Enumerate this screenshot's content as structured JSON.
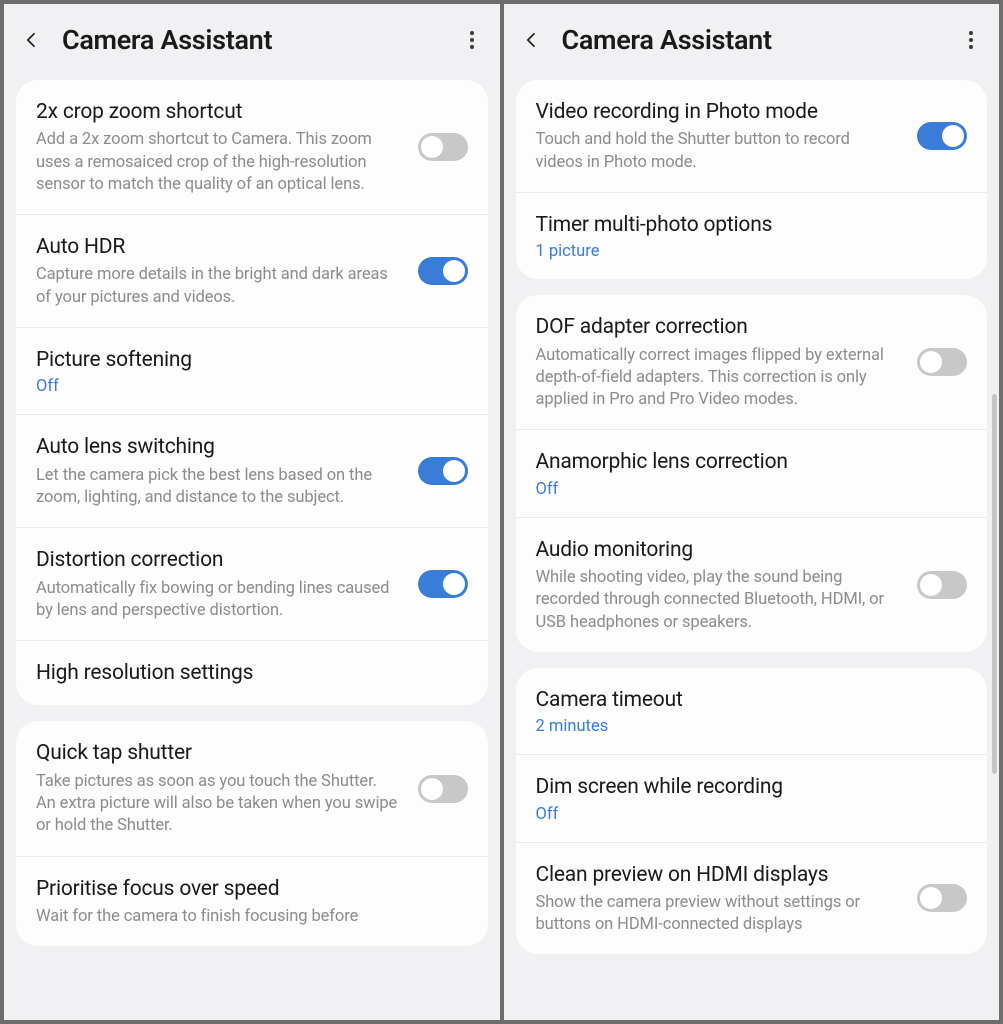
{
  "left": {
    "title": "Camera Assistant",
    "groups": [
      {
        "items": [
          {
            "label": "2x crop zoom shortcut",
            "desc": "Add a 2x zoom shortcut to Camera. This zoom uses a remosaiced crop of the high-resolution sensor to match the quality of an optical lens.",
            "toggle": "off",
            "name": "crop-zoom-shortcut"
          },
          {
            "label": "Auto HDR",
            "desc": "Capture more details in the bright and dark areas of your pictures and videos.",
            "toggle": "on",
            "name": "auto-hdr"
          },
          {
            "label": "Picture softening",
            "value": "Off",
            "name": "picture-softening"
          },
          {
            "label": "Auto lens switching",
            "desc": "Let the camera pick the best lens based on the zoom, lighting, and distance to the subject.",
            "toggle": "on",
            "name": "auto-lens-switching"
          },
          {
            "label": "Distortion correction",
            "desc": "Automatically fix bowing or bending lines caused by lens and perspective distortion.",
            "toggle": "on",
            "name": "distortion-correction"
          },
          {
            "label": "High resolution settings",
            "name": "high-resolution-settings"
          }
        ]
      },
      {
        "items": [
          {
            "label": "Quick tap shutter",
            "desc": "Take pictures as soon as you touch the Shutter. An extra picture will also be taken when you swipe or hold the Shutter.",
            "toggle": "off",
            "name": "quick-tap-shutter"
          },
          {
            "label": "Prioritise focus over speed",
            "desc": "Wait for the camera to finish focusing before",
            "name": "prioritise-focus"
          }
        ]
      }
    ]
  },
  "right": {
    "title": "Camera Assistant",
    "groups": [
      {
        "items": [
          {
            "label": "Video recording in Photo mode",
            "desc": "Touch and hold the Shutter button to record videos in Photo mode.",
            "toggle": "on",
            "name": "video-in-photo-mode"
          },
          {
            "label": "Timer multi-photo options",
            "value": "1 picture",
            "name": "timer-multi-photo"
          }
        ]
      },
      {
        "items": [
          {
            "label": "DOF adapter correction",
            "desc": "Automatically correct images flipped by external depth-of-field adapters. This correction is only applied in Pro and Pro Video modes.",
            "toggle": "off",
            "name": "dof-adapter-correction"
          },
          {
            "label": "Anamorphic lens correction",
            "value": "Off",
            "name": "anamorphic-lens-correction"
          },
          {
            "label": "Audio monitoring",
            "desc": "While shooting video, play the sound being recorded through connected Bluetooth, HDMI, or USB headphones or speakers.",
            "toggle": "off",
            "name": "audio-monitoring"
          }
        ]
      },
      {
        "items": [
          {
            "label": "Camera timeout",
            "value": "2 minutes",
            "name": "camera-timeout"
          },
          {
            "label": "Dim screen while recording",
            "value": "Off",
            "name": "dim-screen-recording"
          },
          {
            "label": "Clean preview on HDMI displays",
            "desc": "Show the camera preview without settings or buttons on HDMI-connected displays",
            "toggle": "off",
            "name": "clean-preview-hdmi"
          }
        ]
      }
    ]
  }
}
